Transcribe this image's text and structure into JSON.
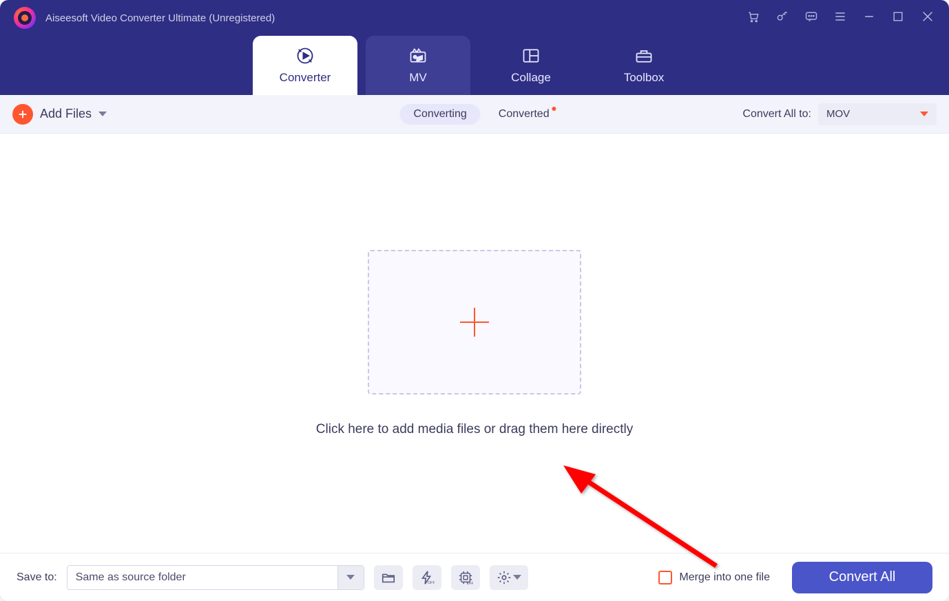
{
  "app": {
    "title": "Aiseesoft Video Converter Ultimate (Unregistered)"
  },
  "tabs": {
    "converter": "Converter",
    "mv": "MV",
    "collage": "Collage",
    "toolbox": "Toolbox"
  },
  "toolbar": {
    "add_files": "Add Files",
    "converting": "Converting",
    "converted": "Converted",
    "convert_all_to": "Convert All to:",
    "format": "MOV"
  },
  "main": {
    "drop_hint": "Click here to add media files or drag them here directly"
  },
  "footer": {
    "save_to": "Save to:",
    "save_path": "Same as source folder",
    "merge_label": "Merge into one file",
    "convert_all": "Convert All"
  }
}
